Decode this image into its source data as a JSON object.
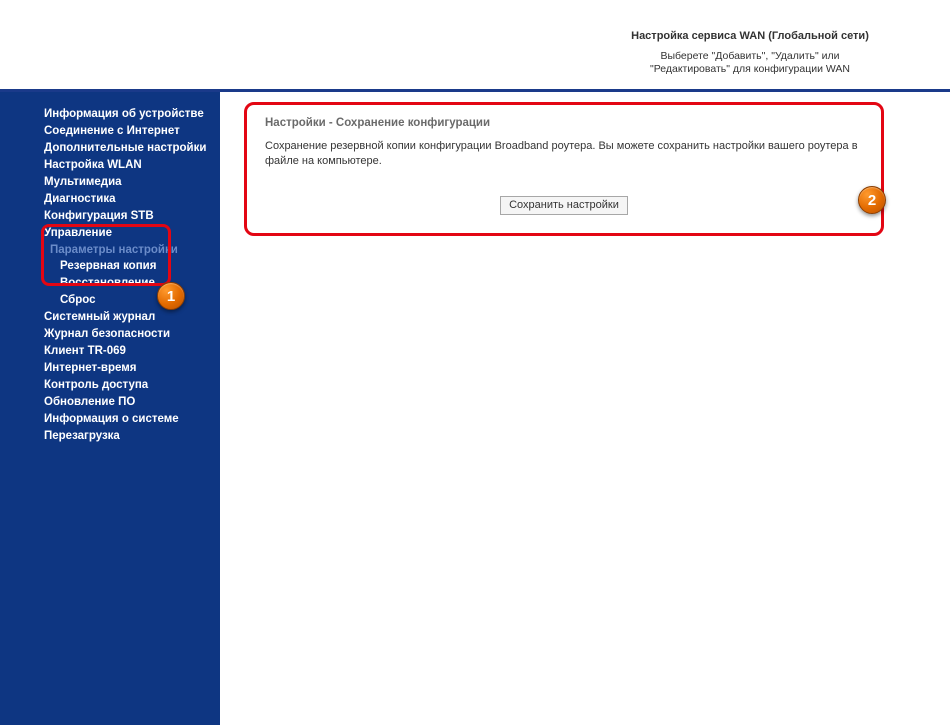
{
  "header": {
    "title": "Настройка сервиса WAN (Глобальной сети)",
    "subtitle": "Выберете \"Добавить\", \"Удалить\" или \"Редактировать\" для конфигурации WAN"
  },
  "sidebar": {
    "items": [
      "Информация об устройстве",
      "Соединение с Интернет",
      "Дополнительные настройки",
      "Настройка WLAN",
      "Мультимедиа",
      "Диагностика",
      "Конфигурация STB",
      "Управление"
    ],
    "submenu": {
      "heading": "Параметры настройки",
      "items": [
        "Резервная копия",
        "Восстановление",
        "Сброс"
      ]
    },
    "items2": [
      "Системный журнал",
      "Журнал безопасности",
      "Клиент TR-069",
      "Интернет-время",
      "Контроль доступа",
      "Обновление ПО",
      "Информация о системе",
      "Перезагрузка"
    ]
  },
  "panel": {
    "title": "Настройки - Сохранение конфигурации",
    "description": "Сохранение резервной копии конфигурации Broadband роутера. Вы можете сохранить настройки вашего роутера в файле на компьютере.",
    "button": "Сохранить настройки"
  },
  "badges": {
    "one": "1",
    "two": "2"
  }
}
